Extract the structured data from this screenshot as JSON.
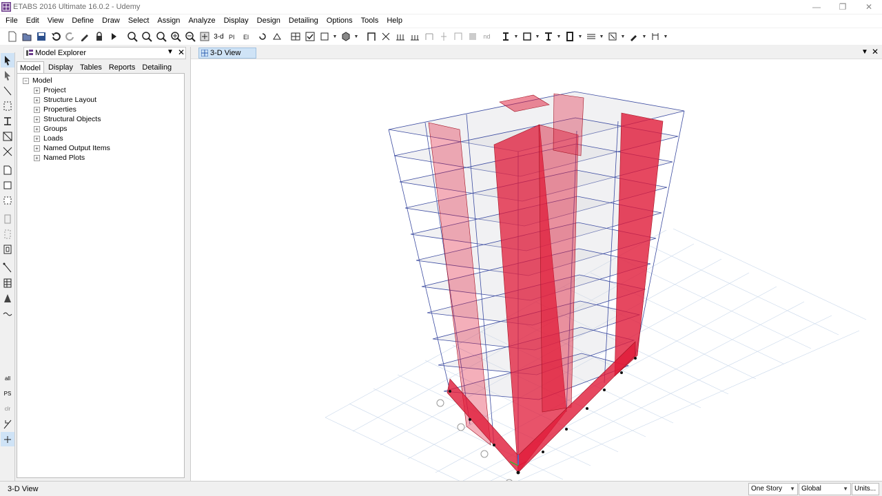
{
  "window": {
    "title": "ETABS 2016 Ultimate 16.0.2 - Udemy",
    "minimize": "—",
    "restore": "❐",
    "close": "✕"
  },
  "menu": [
    "File",
    "Edit",
    "View",
    "Define",
    "Draw",
    "Select",
    "Assign",
    "Analyze",
    "Display",
    "Design",
    "Detailing",
    "Options",
    "Tools",
    "Help"
  ],
  "toolbar": {
    "threed_label": "3-d",
    "nd_label": "nd"
  },
  "explorer": {
    "title": "Model Explorer",
    "tabs": [
      "Model",
      "Display",
      "Tables",
      "Reports",
      "Detailing"
    ],
    "active_tab": "Model",
    "root": "Model",
    "items": [
      "Project",
      "Structure Layout",
      "Properties",
      "Structural Objects",
      "Groups",
      "Loads",
      "Named Output Items",
      "Named Plots"
    ]
  },
  "view": {
    "tab_label": "3-D View"
  },
  "vtoolbar": {
    "label_all": "all",
    "label_ps": "PS",
    "label_clr": "clr"
  },
  "status": {
    "text": "3-D View",
    "story_option": "One Story",
    "coord_option": "Global",
    "units_label": "Units..."
  },
  "colors": {
    "wall_red": "#e01a38",
    "frame_blue": "#3a4aa0",
    "slab_grey": "#d8d8dc"
  }
}
